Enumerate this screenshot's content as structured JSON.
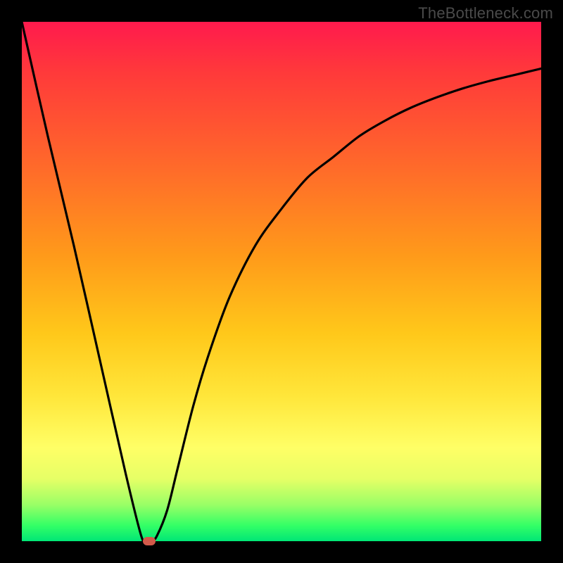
{
  "watermark": "TheBottleneck.com",
  "chart_data": {
    "type": "line",
    "title": "",
    "xlabel": "",
    "ylabel": "",
    "xlim": [
      0,
      100
    ],
    "ylim": [
      0,
      100
    ],
    "grid": false,
    "legend": false,
    "background_gradient": [
      "#ff1a4d",
      "#ff6a2a",
      "#ffc81a",
      "#ffff66",
      "#00e676"
    ],
    "series": [
      {
        "name": "bottleneck-curve",
        "x": [
          0,
          5,
          10,
          15,
          20,
          23,
          24,
          25,
          26,
          28,
          30,
          33,
          36,
          40,
          45,
          50,
          55,
          60,
          65,
          70,
          75,
          80,
          85,
          90,
          95,
          100
        ],
        "y": [
          100,
          78,
          57,
          35,
          13,
          1,
          0,
          0,
          1,
          6,
          14,
          26,
          36,
          47,
          57,
          64,
          70,
          74,
          78,
          81,
          83.5,
          85.5,
          87.2,
          88.6,
          89.8,
          91
        ]
      }
    ],
    "marker": {
      "x": 24.5,
      "y": 0,
      "color": "#d25a4a"
    }
  }
}
